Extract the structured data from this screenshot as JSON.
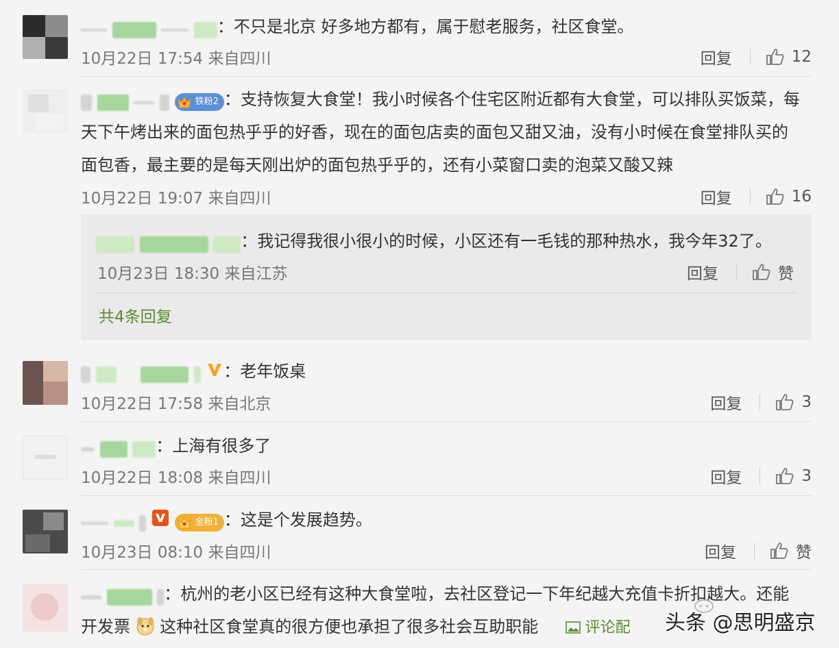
{
  "comments": [
    {
      "text": "不只是北京 好多地方都有，属于慰老服务，社区食堂。",
      "meta": "10月22日 17:54 来自四川",
      "reply": "回复",
      "likes": "12"
    },
    {
      "badge": "铁粉2",
      "text_line1": "支持恢复大食堂！我小时候各个住宅区附近都有大食堂，可以排队买饭菜，每",
      "text_line2": "天下午烤出来的面包热乎乎的好香，现在的面包店卖的面包又甜又油，没有小时候在食堂排队买的",
      "text_line3": "面包香，最主要的是每天刚出炉的面包热乎乎的，还有小菜窗口卖的泡菜又酸又辣",
      "meta": "10月22日 19:07 来自四川",
      "reply": "回复",
      "likes": "16",
      "sub_reply": {
        "text": "我记得我很小很小的时候，小区还有一毛钱的那种热水，我今年32了。",
        "meta": "10月23日 18:30 来自江苏",
        "reply": "回复",
        "likes": "赞"
      },
      "more_replies": "共4条回复"
    },
    {
      "text": "老年饭桌",
      "meta": "10月22日 17:58 来自北京",
      "reply": "回复",
      "likes": "3"
    },
    {
      "text": "上海有很多了",
      "meta": "10月22日 18:08 来自四川",
      "reply": "回复",
      "likes": "3"
    },
    {
      "badge": "金粉1",
      "text": "这是个发展趋势。",
      "meta": "10月23日 08:10 来自四川",
      "reply": "回复",
      "likes": "赞"
    },
    {
      "text_line1": "杭州的老小区已经有这种大食堂啦，去社区登记一下年纪越大充值卡折扣越大。还能",
      "text_line2_a": "开发票",
      "text_line2_b": "这种社区食堂真的很方便也承担了很多社会互助职能",
      "pic_link": "评论配图"
    }
  ],
  "watermark": "头条 @思明盛京",
  "colors": {
    "link_green": "#5a8a33",
    "meta_gray": "#777777",
    "background": "#f4f4f4"
  },
  "icons": [
    "thumbs-up-icon",
    "v-verified-icon",
    "crown-icon",
    "dog-emoji-icon",
    "image-icon"
  ]
}
